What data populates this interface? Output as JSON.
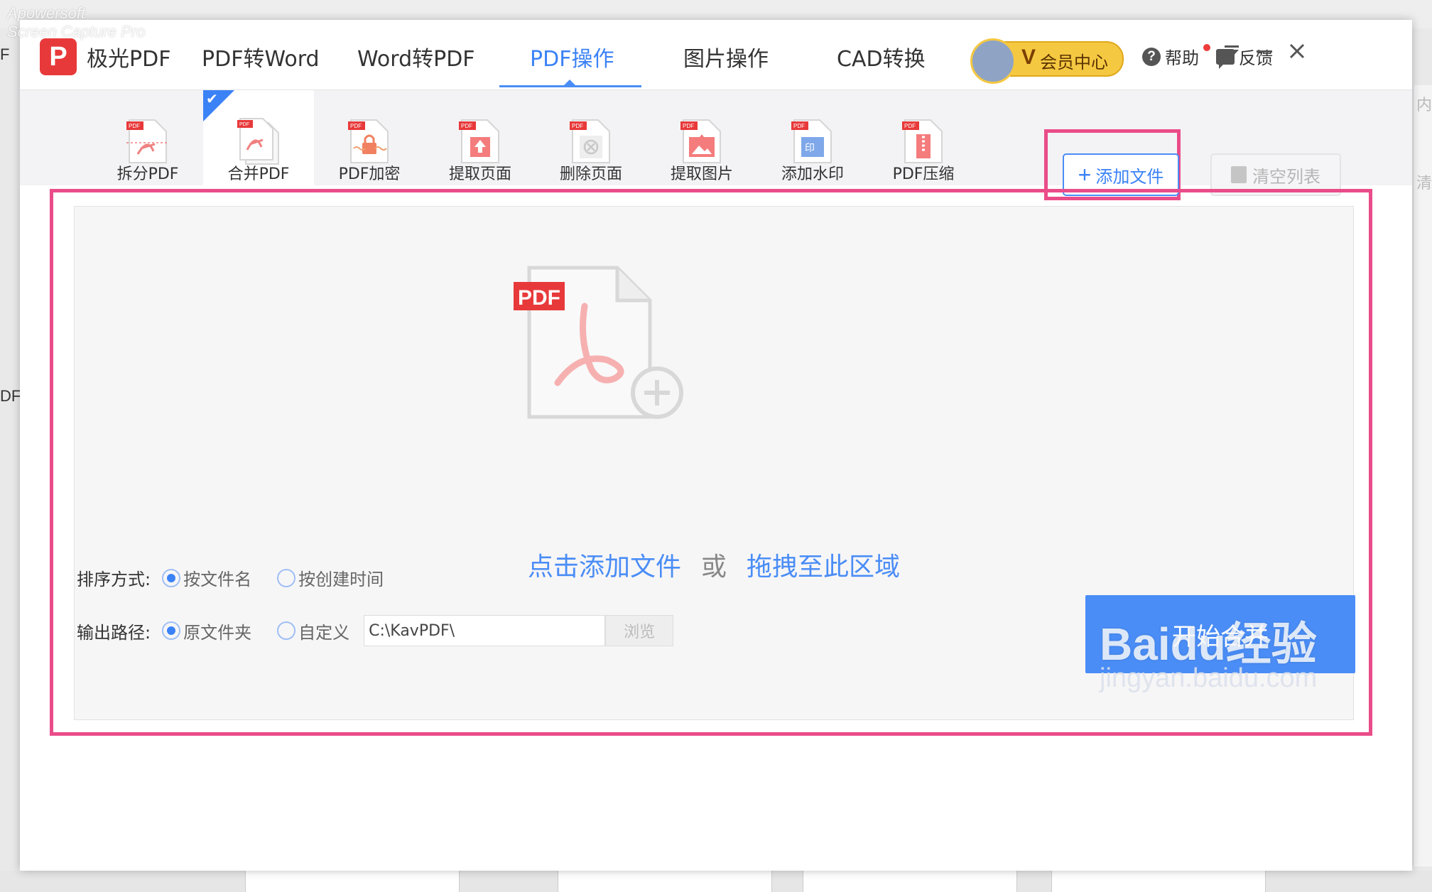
{
  "app": {
    "name": "极光PDF"
  },
  "nav": {
    "tabs": [
      {
        "label": "PDF转Word"
      },
      {
        "label": "Word转PDF"
      },
      {
        "label": "PDF操作",
        "active": true
      },
      {
        "label": "图片操作"
      },
      {
        "label": "CAD转换"
      }
    ]
  },
  "header": {
    "vip_letter": "V",
    "vip_label": "会员中心",
    "help_label": "帮助",
    "feedback_label": "反馈"
  },
  "tools": [
    {
      "label": "拆分PDF",
      "icon": "split-pdf-icon"
    },
    {
      "label": "合并PDF",
      "icon": "merge-pdf-icon",
      "selected": true
    },
    {
      "label": "PDF加密",
      "icon": "encrypt-pdf-icon"
    },
    {
      "label": "提取页面",
      "icon": "extract-page-icon"
    },
    {
      "label": "删除页面",
      "icon": "delete-page-icon"
    },
    {
      "label": "提取图片",
      "icon": "extract-image-icon"
    },
    {
      "label": "添加水印",
      "icon": "watermark-icon"
    },
    {
      "label": "PDF压缩",
      "icon": "compress-pdf-icon"
    }
  ],
  "actions": {
    "add_file": "添加文件",
    "clear_list": "清空列表"
  },
  "dropzone": {
    "badge": "PDF",
    "click_text": "点击添加文件",
    "or_text": "或",
    "drag_text": "拖拽至此区域"
  },
  "options": {
    "sort_label": "排序方式:",
    "sort_by_name": "按文件名",
    "sort_by_time": "按创建时间",
    "sort_selected": "按文件名",
    "output_label": "输出路径:",
    "output_original": "原文件夹",
    "output_custom": "自定义",
    "output_selected": "原文件夹",
    "path_value": "C:\\KavPDF\\",
    "browse": "浏览"
  },
  "start_button": "开始合并",
  "overlays": {
    "capture_watermark_line1": "Apowersoft",
    "capture_watermark_line2": "Screen Capture Pro",
    "baidu_logo": "Baidu经验",
    "baidu_url": "jingyan.baidu.com"
  },
  "colors": {
    "accent": "#3b82f6",
    "highlight": "#ea4c89",
    "logo": "#e8393a",
    "vip": "#f5c842"
  }
}
